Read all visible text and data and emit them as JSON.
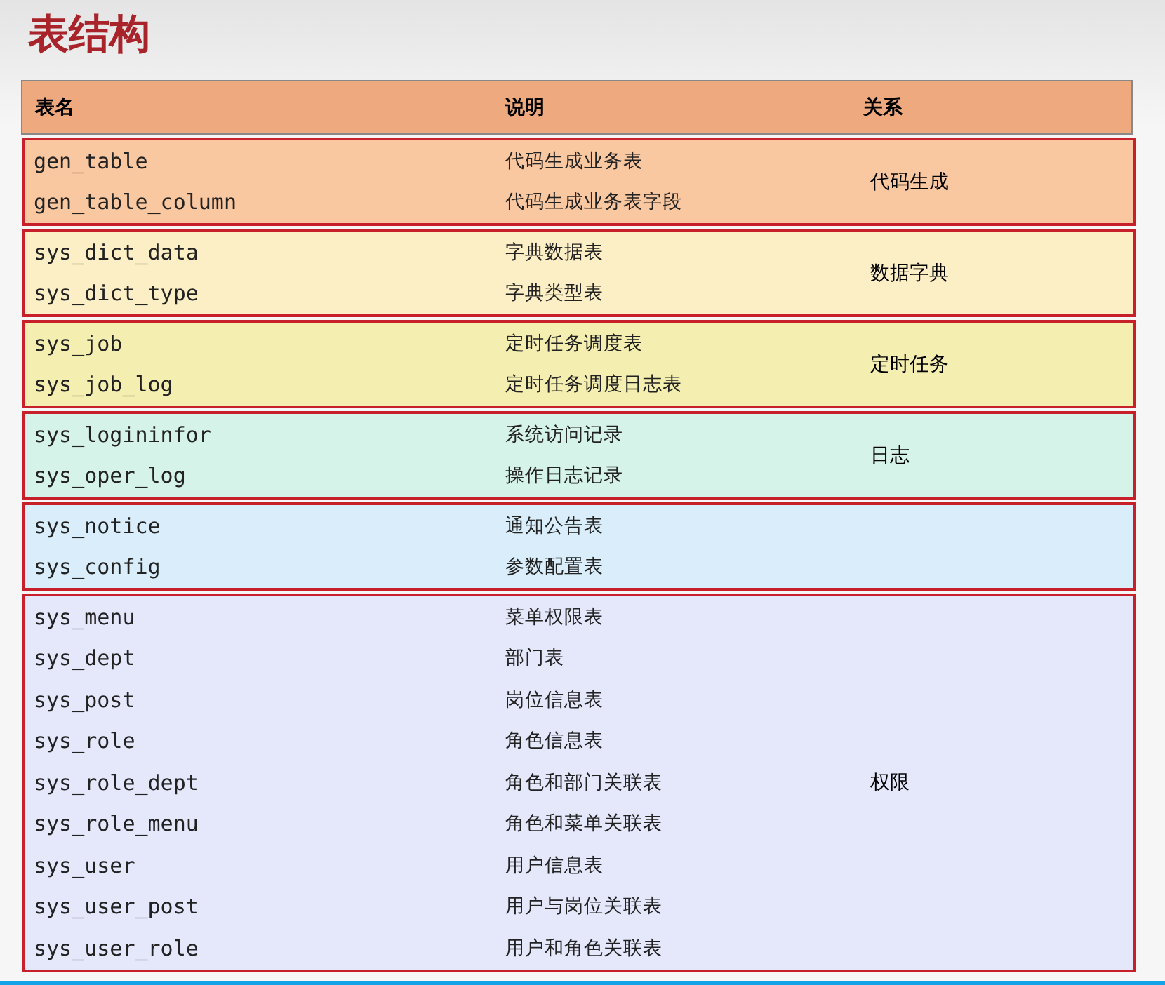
{
  "title": "表结构",
  "table": {
    "columns": [
      "表名",
      "说明",
      "关系"
    ],
    "groups": [
      {
        "color": "#f9c7a0",
        "relation": "代码生成",
        "rows": [
          {
            "name": "gen_table",
            "description": "代码生成业务表"
          },
          {
            "name": "gen_table_column",
            "description": "代码生成业务表字段"
          }
        ]
      },
      {
        "color": "#fcefc6",
        "relation": "数据字典",
        "rows": [
          {
            "name": "sys_dict_data",
            "description": "字典数据表"
          },
          {
            "name": "sys_dict_type",
            "description": "字典类型表"
          }
        ]
      },
      {
        "color": "#f4eeb0",
        "relation": "定时任务",
        "rows": [
          {
            "name": "sys_job",
            "description": "定时任务调度表"
          },
          {
            "name": "sys_job_log",
            "description": "定时任务调度日志表"
          }
        ]
      },
      {
        "color": "#d6f3ea",
        "relation": "日志",
        "rows": [
          {
            "name": "sys_logininfor",
            "description": "系统访问记录"
          },
          {
            "name": "sys_oper_log",
            "description": "操作日志记录"
          }
        ]
      },
      {
        "color": "#d9eefa",
        "rows": [
          {
            "name": "sys_notice",
            "description": "通知公告表"
          },
          {
            "name": "sys_config",
            "description": "参数配置表"
          }
        ]
      },
      {
        "color": "#e5e8fb",
        "relation": "权限",
        "rows": [
          {
            "name": "sys_menu",
            "description": "菜单权限表"
          },
          {
            "name": "sys_dept",
            "description": "部门表"
          },
          {
            "name": "sys_post",
            "description": "岗位信息表"
          },
          {
            "name": "sys_role",
            "description": "角色信息表"
          },
          {
            "name": "sys_role_dept",
            "description": "角色和部门关联表"
          },
          {
            "name": "sys_role_menu",
            "description": "角色和菜单关联表"
          },
          {
            "name": "sys_user",
            "description": "用户信息表"
          },
          {
            "name": "sys_user_post",
            "description": "用户与岗位关联表"
          },
          {
            "name": "sys_user_role",
            "description": "用户和角色关联表"
          }
        ]
      }
    ]
  },
  "seek_bar": {
    "level": 1
  }
}
